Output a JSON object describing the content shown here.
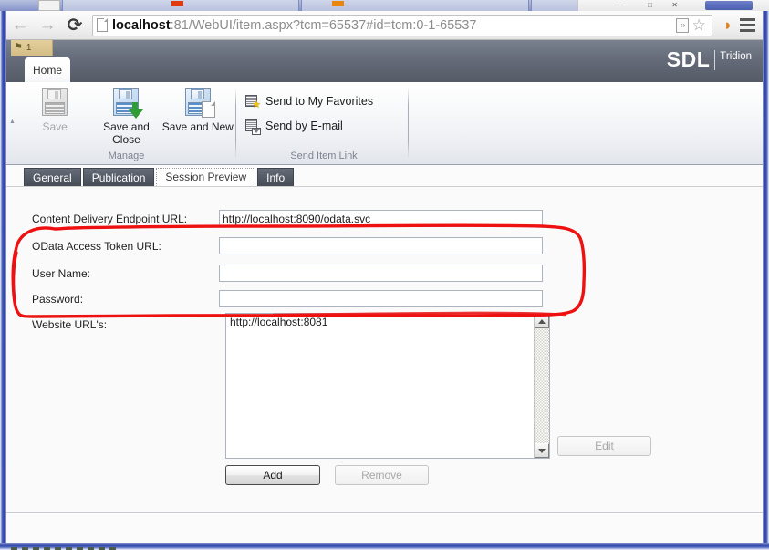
{
  "browser": {
    "nav": {
      "back_glyph": "←",
      "forward_glyph": "→",
      "reload_glyph": "⟳"
    },
    "url_host": "localhost",
    "url_rest": ":81/WebUI/item.aspx?tcm=65537#id=tcm:0-1-65537",
    "url_full": "localhost:81/WebUI/item.aspx?tcm=65537#id=tcm:0-1-65537",
    "code_icon_glyph": "‹›",
    "star_glyph": "☆",
    "rss_glyph": "◗"
  },
  "app": {
    "flag_badge": {
      "glyph": "⚑",
      "count": "1"
    },
    "home_tab_label": "Home",
    "brand": {
      "primary": "SDL",
      "secondary": "Tridion"
    }
  },
  "ribbon": {
    "groups": [
      {
        "name": "manage",
        "label": "Manage",
        "buttons": [
          {
            "name": "save",
            "label": "Save",
            "icon": "floppy-disk-icon",
            "disabled": true
          },
          {
            "name": "save-and-close",
            "label": "Save and Close",
            "icon": "floppy-disk-arrow-icon",
            "disabled": false
          },
          {
            "name": "save-and-new",
            "label": "Save and New",
            "icon": "floppy-disk-page-icon",
            "disabled": false
          }
        ]
      },
      {
        "name": "send-item-link",
        "label": "Send Item Link",
        "buttons": [
          {
            "name": "send-to-my-favorites",
            "label": "Send to My Favorites",
            "icon": "card-star-icon",
            "disabled": false
          },
          {
            "name": "send-by-email",
            "label": "Send by E-mail",
            "icon": "card-envelope-icon",
            "disabled": false
          }
        ]
      }
    ]
  },
  "tabs": [
    {
      "name": "general",
      "label": "General",
      "active": false
    },
    {
      "name": "publication",
      "label": "Publication",
      "active": false
    },
    {
      "name": "session-preview",
      "label": "Session Preview",
      "active": true
    },
    {
      "name": "info",
      "label": "Info",
      "active": false
    }
  ],
  "form": {
    "fields": [
      {
        "name": "content-delivery-endpoint-url",
        "label": "Content Delivery Endpoint URL:",
        "value": "http://localhost:8090/odata.svc",
        "placeholder": "",
        "type": "text"
      },
      {
        "name": "odata-access-token-url",
        "label": "OData Access Token URL:",
        "value": "",
        "placeholder": "",
        "type": "text"
      },
      {
        "name": "user-name",
        "label": "User Name:",
        "value": "",
        "placeholder": "",
        "type": "text"
      },
      {
        "name": "password",
        "label": "Password:",
        "value": "",
        "placeholder": "",
        "type": "password"
      }
    ],
    "website_urls": {
      "label": "Website URL's:",
      "items": [
        "http://localhost:8081"
      ]
    },
    "buttons": {
      "add": {
        "label": "Add",
        "disabled": false
      },
      "remove": {
        "label": "Remove",
        "disabled": true
      },
      "edit": {
        "label": "Edit",
        "disabled": true
      }
    }
  },
  "annotation": {
    "type": "hand-drawn-ellipse-highlight",
    "color": "#ee1111",
    "encircles": [
      "odata-access-token-url",
      "user-name",
      "password"
    ]
  },
  "colors": {
    "accent_blue": "#2b3f9e",
    "ribbon_dark": "#555b66",
    "annotation_red": "#ee1111",
    "brand_white": "#ffffff",
    "rss_orange": "#e08020"
  }
}
